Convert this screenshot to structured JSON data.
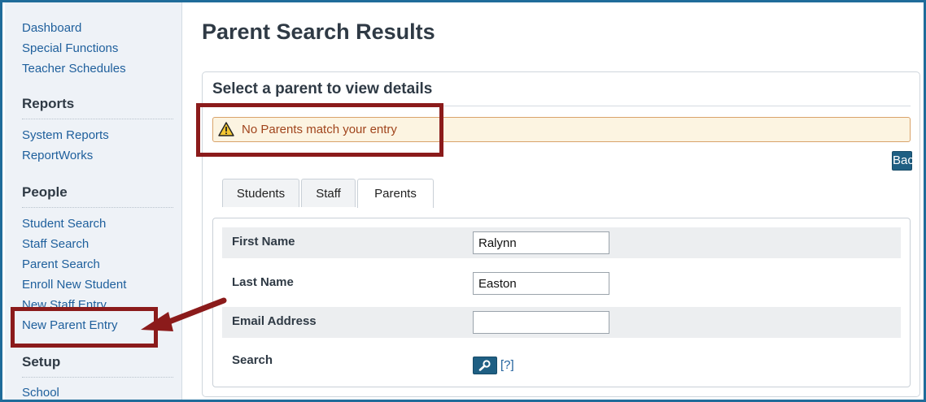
{
  "sidebar": {
    "top_links": [
      "Dashboard",
      "Special Functions",
      "Teacher Schedules"
    ],
    "sections": [
      {
        "heading": "Reports",
        "links": [
          "System Reports",
          "ReportWorks"
        ]
      },
      {
        "heading": "People",
        "links": [
          "Student Search",
          "Staff Search",
          "Parent Search",
          "Enroll New Student",
          "New Staff Entry",
          "New Parent Entry"
        ]
      },
      {
        "heading": "Setup",
        "links": [
          "School"
        ]
      }
    ]
  },
  "page": {
    "title": "Parent Search Results",
    "panel_title": "Select a parent to view details",
    "alert_text": "No Parents match your entry",
    "back_label": "Back",
    "tabs": [
      {
        "label": "Students",
        "active": false
      },
      {
        "label": "Staff",
        "active": false
      },
      {
        "label": "Parents",
        "active": true
      }
    ],
    "form": {
      "first_name_label": "First Name",
      "first_name_value": "Ralynn",
      "last_name_label": "Last Name",
      "last_name_value": "Easton",
      "email_label": "Email Address",
      "email_value": "",
      "search_label": "Search",
      "help_text": "[?]"
    }
  },
  "colors": {
    "accent": "#1f5f83",
    "link": "#1e5f9c",
    "alert_bg": "#fcf4e1",
    "alert_text": "#a0441c",
    "annotation": "#8b1b1b"
  },
  "icons": {
    "alert": "warning-icon",
    "search": "magnifier-icon"
  }
}
